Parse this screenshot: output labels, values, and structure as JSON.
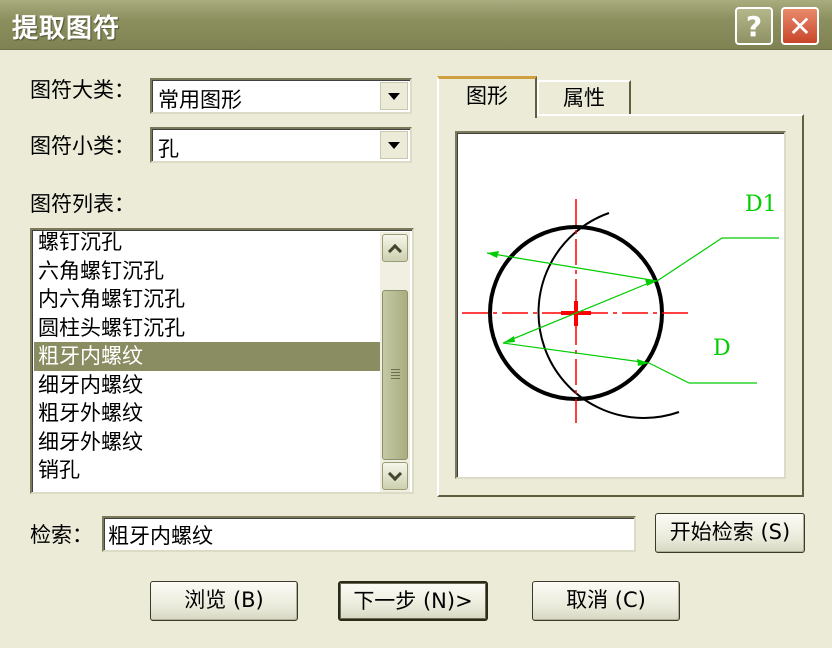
{
  "window": {
    "title": "提取图符",
    "help_label": "?",
    "close_label": "✕"
  },
  "category": {
    "label": "图符大类：",
    "value": "常用图形"
  },
  "subcategory": {
    "label": "图符小类：",
    "value": "孔"
  },
  "symbol_list": {
    "label": "图符列表：",
    "items": [
      "螺钉沉孔",
      "六角螺钉沉孔",
      "内六角螺钉沉孔",
      "圆柱头螺钉沉孔",
      "粗牙内螺纹",
      "细牙内螺纹",
      "粗牙外螺纹",
      "细牙外螺纹",
      "销孔"
    ],
    "selected_index": 4
  },
  "tabs": [
    {
      "label": "图形",
      "active": true
    },
    {
      "label": "属性",
      "active": false
    }
  ],
  "preview": {
    "dim_labels": [
      "D1",
      "D"
    ],
    "colors": {
      "outline": "#000000",
      "centerline": "#ff0000",
      "dimension": "#00cc00"
    }
  },
  "search": {
    "label": "检索：",
    "value": "粗牙内螺纹",
    "button_label": "开始检索 (S)"
  },
  "buttons": {
    "browse": "浏览 (B)",
    "next": "下一步 (N)>",
    "cancel": "取消 (C)"
  },
  "icons": {
    "help": "help-icon",
    "close": "close-icon",
    "dropdown": "chevron-down-icon",
    "scroll_up": "chevron-up-icon",
    "scroll_down": "chevron-down-icon"
  }
}
